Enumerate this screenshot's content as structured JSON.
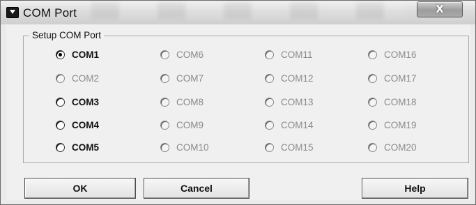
{
  "window": {
    "title": "COM Port",
    "close_label": "X"
  },
  "group": {
    "label": "Setup COM Port"
  },
  "ports": {
    "col1": [
      {
        "label": "COM1",
        "enabled": true,
        "checked": true
      },
      {
        "label": "COM2",
        "enabled": false,
        "checked": false
      },
      {
        "label": "COM3",
        "enabled": true,
        "checked": false
      },
      {
        "label": "COM4",
        "enabled": true,
        "checked": false
      },
      {
        "label": "COM5",
        "enabled": true,
        "checked": false
      }
    ],
    "col2": [
      {
        "label": "COM6",
        "enabled": false,
        "checked": false
      },
      {
        "label": "COM7",
        "enabled": false,
        "checked": false
      },
      {
        "label": "COM8",
        "enabled": false,
        "checked": false
      },
      {
        "label": "COM9",
        "enabled": false,
        "checked": false
      },
      {
        "label": "COM10",
        "enabled": false,
        "checked": false
      }
    ],
    "col3": [
      {
        "label": "COM11",
        "enabled": false,
        "checked": false
      },
      {
        "label": "COM12",
        "enabled": false,
        "checked": false
      },
      {
        "label": "COM13",
        "enabled": false,
        "checked": false
      },
      {
        "label": "COM14",
        "enabled": false,
        "checked": false
      },
      {
        "label": "COM15",
        "enabled": false,
        "checked": false
      }
    ],
    "col4": [
      {
        "label": "COM16",
        "enabled": false,
        "checked": false
      },
      {
        "label": "COM17",
        "enabled": false,
        "checked": false
      },
      {
        "label": "COM18",
        "enabled": false,
        "checked": false
      },
      {
        "label": "COM19",
        "enabled": false,
        "checked": false
      },
      {
        "label": "COM20",
        "enabled": false,
        "checked": false
      }
    ]
  },
  "buttons": {
    "ok": "OK",
    "cancel": "Cancel",
    "help": "Help"
  },
  "colors": {
    "enabled_text": "#111111",
    "disabled_text": "#8a8a8a",
    "window_bg": "#f0f0f0"
  }
}
